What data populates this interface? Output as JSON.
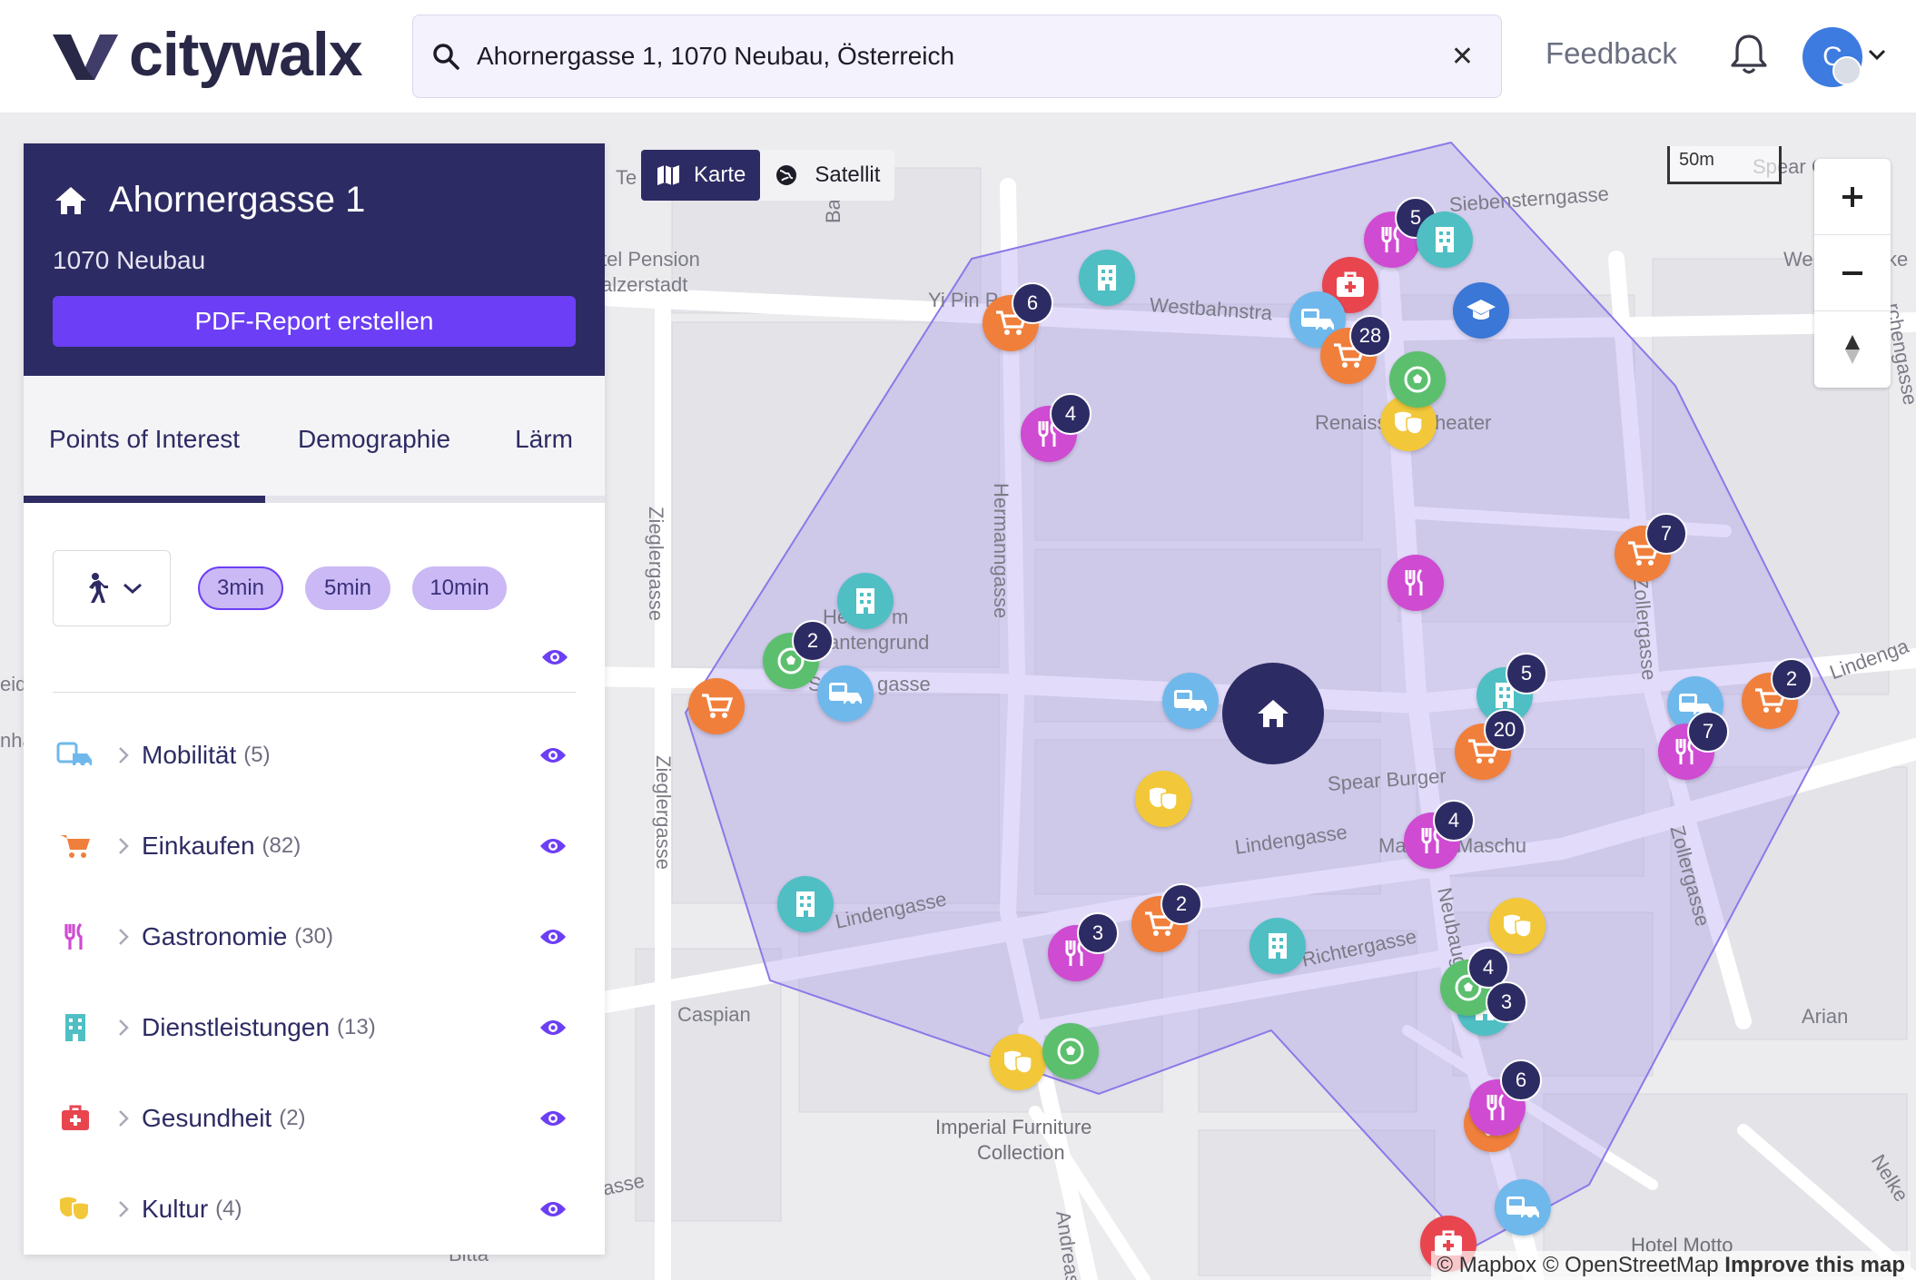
{
  "header": {
    "logo_text": "citywalx",
    "search_value": "Ahornergasse 1, 1070 Neubau, Österreich",
    "feedback_label": "Feedback",
    "avatar_initial": "C"
  },
  "sidebar": {
    "title": "Ahornergasse 1",
    "subtitle": "1070 Neubau",
    "report_button": "PDF-Report erstellen",
    "tabs": [
      "Points of Interest",
      "Demographie",
      "Lärm"
    ],
    "time_pills": [
      "3min",
      "5min",
      "10min"
    ],
    "categories": [
      {
        "label": "Mobilität",
        "count": "(5)",
        "icon": "bus-car-icon",
        "color": "#6fb8ec"
      },
      {
        "label": "Einkaufen",
        "count": "(82)",
        "icon": "cart-icon",
        "color": "#f07f3c"
      },
      {
        "label": "Gastronomie",
        "count": "(30)",
        "icon": "restaurant-icon",
        "color": "#cf4bd2"
      },
      {
        "label": "Dienstleistungen",
        "count": "(13)",
        "icon": "building-icon",
        "color": "#4fbfc4"
      },
      {
        "label": "Gesundheit",
        "count": "(2)",
        "icon": "first-aid-icon",
        "color": "#e8454f"
      },
      {
        "label": "Kultur",
        "count": "(4)",
        "icon": "theater-masks-icon",
        "color": "#f2c83a"
      }
    ]
  },
  "map": {
    "toggle": {
      "map_label": "Karte",
      "satellite_label": "Satellit"
    },
    "scale_label": "50m",
    "attribution": {
      "mapbox": "© Mapbox",
      "osm": "© OpenStreetMap",
      "improve": "Improve this map"
    },
    "street_labels": [
      "Siebensterngasse",
      "Westbahnstra",
      "Yi Pin P",
      "tel Pension",
      "alzerstadt",
      "Hermanngasse",
      "Zieglergasse",
      "Zieglergasse",
      "Lindengasse",
      "Lindengasse",
      "Spear Burger",
      "Richtergasse",
      "Neubaug",
      "Zollergasse",
      "Zollergasse",
      "Lindenga",
      "Caspian",
      "Arian",
      "Renaiss",
      "heater",
      "Ma",
      "Maschu",
      "Imperial Furniture",
      "Collection",
      "Hotel Motto",
      "Andreasg",
      "Bitta",
      "asse",
      "Spear G",
      "We",
      "ke",
      "rchengasse",
      "Nelke",
      "eid",
      "nha",
      "Ba",
      "Te",
      "He",
      "m",
      "antengrund",
      "S",
      "gasse"
    ],
    "badges": [
      "5",
      "6",
      "28",
      "4",
      "7",
      "2",
      "5",
      "2",
      "20",
      "7",
      "4",
      "2",
      "3",
      "4",
      "3",
      "6"
    ]
  },
  "colors": {
    "brand_dark": "#2d2b63",
    "brand_purple": "#6c3ef5",
    "mobility": "#6fb8ec",
    "shopping": "#f07f3c",
    "food": "#cf4bd2",
    "services": "#4fbfc4",
    "health": "#e8454f",
    "culture": "#f2c83a",
    "leisure": "#5cbf6e",
    "education": "#3a77d6"
  }
}
